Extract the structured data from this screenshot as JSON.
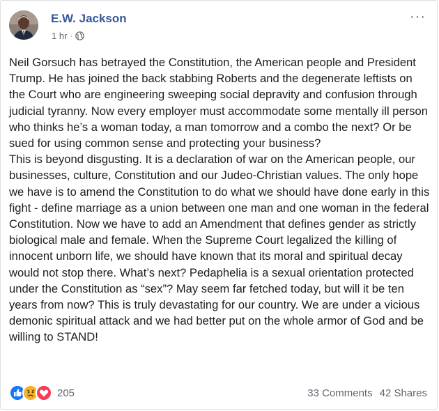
{
  "post": {
    "author": "E.W. Jackson",
    "time": "1 hr",
    "separator": "·",
    "more": "···",
    "paragraphs": [
      "Neil Gorsuch has betrayed the Constitution, the American people and President Trump. He has joined the back stabbing Roberts and the degenerate leftists on the Court who are engineering sweeping social depravity and confusion through judicial tyranny. Now every employer must accommodate some mentally ill person who thinks he’s a woman today, a man tomorrow and a combo the next? Or be sued for using common sense and protecting your business?",
      "This is beyond disgusting. It is a declaration of war on the American people, our businesses, culture, Constitution and our Judeo-Christian values. The only hope we have is to amend the Constitution to do what we should have done early in this fight - define marriage as a union between one man and one woman in the federal Constitution. Now we have to add an Amendment that defines gender as strictly biological male and female. When the Supreme Court legalized the killing of innocent unborn life, we should have known that its moral and spiritual decay would not stop there. What’s next? Pedaphelia is a sexual orientation protected under the Constitution as “sex”? May seem far fetched today, but will it be ten years from now? This is truly devastating for our country. We are under a vicious demonic spiritual attack and we had better put on the whole armor of God and be willing to STAND!"
    ]
  },
  "engagement": {
    "reaction_count": "205",
    "comments": "33 Comments",
    "shares": "42 Shares",
    "reactions": [
      {
        "icon": "like-reaction-icon",
        "color": "#1877f2"
      },
      {
        "icon": "sad-reaction-icon",
        "color": "#f7b125"
      },
      {
        "icon": "love-reaction-icon",
        "color": "#f33e58"
      }
    ]
  },
  "colors": {
    "author_link": "#385898",
    "secondary_text": "#606770",
    "body_text": "#1c1e21"
  }
}
